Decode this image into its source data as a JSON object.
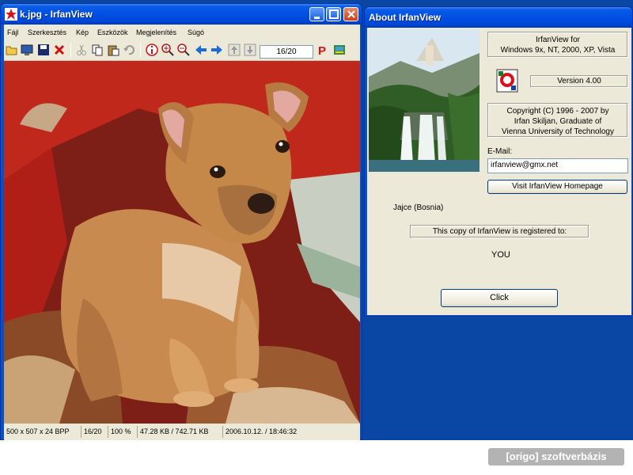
{
  "main_window": {
    "title": "k.jpg - IrfanView",
    "menu": [
      "Fájl",
      "Szerkesztés",
      "Kép",
      "Eszközök",
      "Megjelenítés",
      "Súgó"
    ],
    "page_indicator": "16/20",
    "status": {
      "dimensions": "500 x 507 x 24 BPP",
      "page": "16/20",
      "zoom": "100 %",
      "size": "47.28 KB / 742.71 KB",
      "datetime": "2006.10.12. / 18:46:32"
    }
  },
  "about_dialog": {
    "title": "About  IrfanView",
    "product_line1": "IrfanView for",
    "product_line2": "Windows 9x, NT, 2000, XP, Vista",
    "version": "Version 4.00",
    "copyright_line1": "Copyright (C) 1996 - 2007 by",
    "copyright_line2": "Irfan Skiljan, Graduate of",
    "copyright_line3": "Vienna University of Technology",
    "photo_caption": "Jajce (Bosnia)",
    "email_label": "E-Mail:",
    "email_value": "irfanview@gmx.net",
    "homepage_button": "Visit IrfanView Homepage",
    "registered_label": "This copy of IrfanView is registered to:",
    "registered_to": "YOU",
    "ok_button": "Click"
  },
  "watermark": "[origo] szoftverbázis",
  "icons": [
    "app-icon",
    "open-icon",
    "slideshow-icon",
    "save-icon",
    "delete-icon",
    "cut-icon",
    "copy-icon",
    "paste-icon",
    "undo-icon",
    "info-icon",
    "zoom-in-icon",
    "zoom-out-icon",
    "prev-icon",
    "next-icon",
    "first-page-icon",
    "last-page-icon",
    "paint-icon",
    "scan-icon"
  ]
}
